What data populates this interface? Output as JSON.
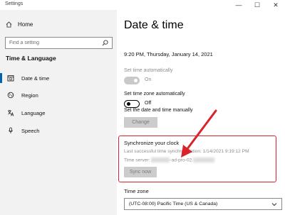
{
  "window": {
    "title": "Settings",
    "minimize": "—",
    "maximize": "☐",
    "close": "✕"
  },
  "sidebar": {
    "home_label": "Home",
    "search_placeholder": "Find a setting",
    "section_title": "Time & Language",
    "items": [
      {
        "label": "Date & time",
        "icon": "clock-icon",
        "active": true
      },
      {
        "label": "Region",
        "icon": "globe-icon",
        "active": false
      },
      {
        "label": "Language",
        "icon": "language-icon",
        "active": false
      },
      {
        "label": "Speech",
        "icon": "microphone-icon",
        "active": false
      }
    ]
  },
  "main": {
    "title": "Date & time",
    "current_datetime": "9:20 PM, Thursday, January 14, 2021",
    "set_time_auto": {
      "label": "Set time automatically",
      "state": "On",
      "enabled": false
    },
    "set_tz_auto": {
      "label": "Set time zone automatically",
      "state": "Off",
      "enabled": true
    },
    "manual": {
      "label": "Set the date and time manually",
      "button": "Change"
    },
    "sync": {
      "title": "Synchronize your clock",
      "last_sync": "Last successful time synchronization: 1/14/2021 9:19:12 PM",
      "server_prefix": "Time server:",
      "server_name": "-ad-pro-02",
      "button": "Sync now"
    },
    "timezone": {
      "label": "Time zone",
      "value": "(UTC-08:00) Pacific Time (US & Canada)"
    }
  },
  "colors": {
    "accent": "#0063b1",
    "highlight_red": "#d9222a",
    "sidebar_bg": "#f2f2f2"
  }
}
